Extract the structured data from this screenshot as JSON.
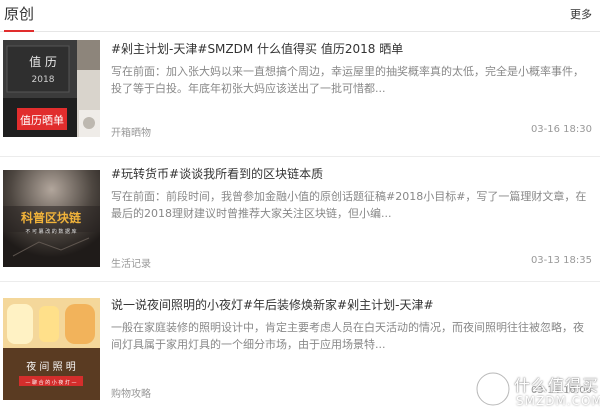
{
  "header": {
    "title": "原创",
    "more_label": "更多"
  },
  "items": [
    {
      "title": "#剁主计划-天津#SMZDM 什么值得买 值历2018 晒单",
      "excerpt": "写在前面：加入张大妈以来一直想搞个周边，幸运屋里的抽奖概率真的太低，完全是小概率事件，投了等于白投。年底年初张大妈应该送出了一批可惜都...",
      "category": "开箱晒物",
      "date": "03-16 18:30",
      "thumb": {
        "caption": "值历晒单",
        "book_title": "值 历",
        "book_year": "2018",
        "icon": "calendar-box-image"
      }
    },
    {
      "title": "#玩转货币#谈谈我所看到的区块链本质",
      "excerpt": "写在前面：前段时间，我曾参加金融小值的原创话题征稿#2018小目标#，写了一篇理财文章，在最后的2018理财建议时曾推荐大家关注区块链，但小编...",
      "category": "生活记录",
      "date": "03-13 18:35",
      "thumb": {
        "caption": "科普区块链",
        "subcaption": "不 可 篡 改 的 数 据 库",
        "icon": "blockchain-cover-image"
      }
    },
    {
      "title": "说一说夜间照明的小夜灯#年后装修焕新家#剁主计划-天津#",
      "excerpt": "一般在家庭装修的照明设计中，肯定主要考虑人员在白天活动的情况，而夜间照明往往被忽略，夜间灯具属于家用灯具的一个细分市场，由于应用场景特...",
      "category": "购物攻略",
      "date": "03-14 10:00",
      "thumb": {
        "caption": "夜 间 照 明",
        "subcaption": "— 聊 合 的 小 夜 灯 —",
        "icon": "night-light-image"
      }
    }
  ],
  "watermark": {
    "title": "什么值得买",
    "domain": "SMZDM.COM"
  },
  "colors": {
    "accent": "#e12d2d"
  }
}
